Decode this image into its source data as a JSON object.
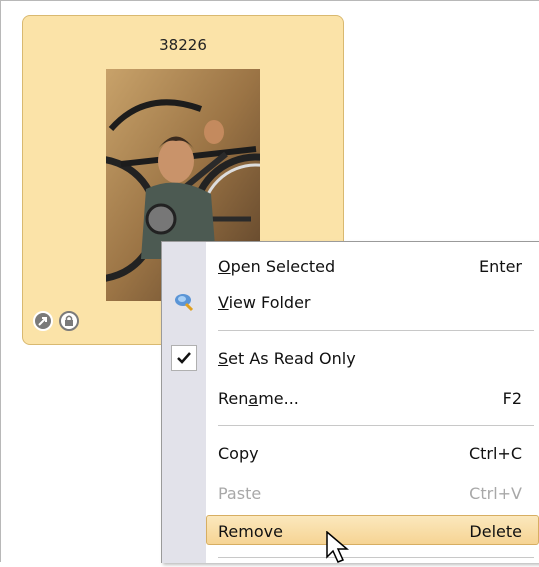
{
  "thumbnail": {
    "title": "38226"
  },
  "context_menu": {
    "items": [
      {
        "label_pre": "",
        "accel": "O",
        "label_post": "pen Selected",
        "shortcut": "Enter"
      },
      {
        "label_pre": "",
        "accel": "V",
        "label_post": "iew Folder",
        "shortcut": ""
      },
      {
        "label_pre": "",
        "accel": "S",
        "label_post": "et As Read Only",
        "shortcut": ""
      },
      {
        "label_pre": "Ren",
        "accel": "a",
        "label_post": "me...",
        "shortcut": "F2"
      },
      {
        "label_pre": "Copy",
        "accel": "",
        "label_post": "",
        "shortcut": "Ctrl+C"
      },
      {
        "label_pre": "Paste",
        "accel": "",
        "label_post": "",
        "shortcut": "Ctrl+V"
      },
      {
        "label_pre": "Remove",
        "accel": "",
        "label_post": "",
        "shortcut": "Delete"
      }
    ]
  },
  "colors": {
    "card_background": "#fbe3a8",
    "menu_gutter": "#e2e2ea",
    "highlight": "#f6d494",
    "disabled_text": "#a8a8a8"
  },
  "icons": [
    "shortcut-arrow-icon",
    "lock-icon",
    "view-folder-icon",
    "checkmark-icon",
    "mouse-pointer-icon"
  ]
}
